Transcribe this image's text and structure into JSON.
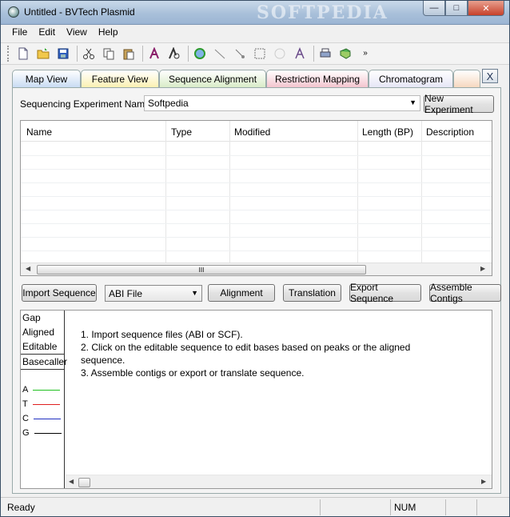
{
  "window": {
    "title": "Untitled - BVTech Plasmid",
    "watermark": "SOFTPEDIA"
  },
  "menu": [
    "File",
    "Edit",
    "View",
    "Help"
  ],
  "tabs": [
    {
      "label": "Map View",
      "color": "#c9dcf3"
    },
    {
      "label": "Feature View",
      "color": "#fbf1b3"
    },
    {
      "label": "Sequence Alignment",
      "color": "#d9ecc8"
    },
    {
      "label": "Restriction Mapping",
      "color": "#f4c5cf"
    },
    {
      "label": "Chromatogram",
      "color": "#e6e6f6"
    },
    {
      "label": "",
      "color": "#f6d8bf"
    }
  ],
  "tab_close_label": "X",
  "experiment": {
    "label": "Sequencing Experiment Name:",
    "value": "Softpedia",
    "new_button": "New Experiment"
  },
  "table": {
    "columns": [
      "Name",
      "Type",
      "Modified",
      "Length (BP)",
      "Description"
    ],
    "scroll_thumb_label": "III"
  },
  "actions": {
    "import": "Import Sequence",
    "file_type": "ABI File",
    "alignment": "Alignment",
    "translation": "Translation",
    "export": "Export Sequence",
    "assemble": "Assemble Contigs"
  },
  "legend": {
    "items": [
      "Gap",
      "Aligned",
      "Editable",
      "Basecaller"
    ],
    "bases": [
      {
        "label": "A",
        "color": "#20c020"
      },
      {
        "label": "T",
        "color": "#e02020"
      },
      {
        "label": "C",
        "color": "#2030c0"
      },
      {
        "label": "G",
        "color": "#000000"
      }
    ]
  },
  "instructions": [
    "1. Import sequence files (ABI or SCF).",
    "2. Click on the editable sequence to edit bases based on peaks or the aligned sequence.",
    "3. Assemble contigs or export or translate sequence."
  ],
  "status": {
    "text": "Ready",
    "num": "NUM"
  }
}
